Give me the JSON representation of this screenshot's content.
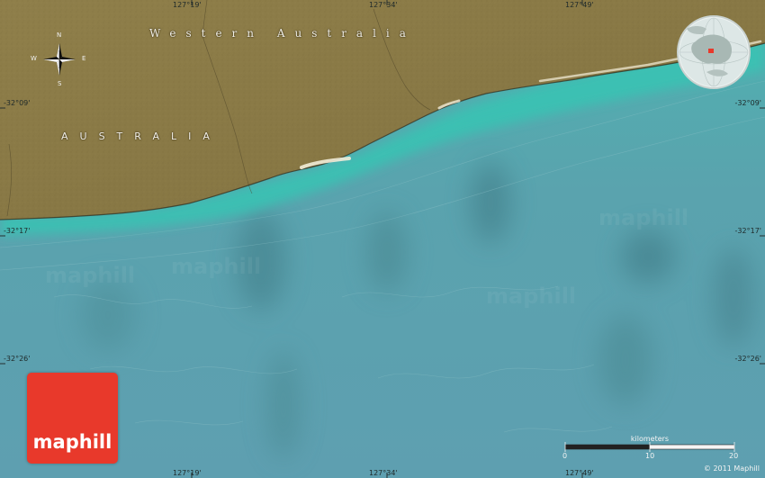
{
  "map": {
    "region_label": "Western Australia",
    "country_label": "AUSTRALIA",
    "colors": {
      "land": "#8a7a45",
      "land_dark": "#6d5f33",
      "sea": "#5aa3ae",
      "shallow": "#3fc0b2",
      "beach": "#efe9d6",
      "logo_red": "#e8392b"
    },
    "longitude_ticks": [
      "127°19'",
      "127°34'",
      "127°49'"
    ],
    "latitude_ticks": [
      "-32°09'",
      "-32°17'",
      "-32°26'"
    ],
    "compass": {
      "n": "N",
      "s": "S",
      "e": "E",
      "w": "W",
      "icon": "compass-rose-icon"
    },
    "globe_icon": "globe-inset-icon",
    "logo": {
      "text": "maphill"
    },
    "scale": {
      "title": "kilometers",
      "start": "0",
      "mid": "10",
      "end": "20"
    },
    "copyright": "© 2011 Maphill"
  }
}
